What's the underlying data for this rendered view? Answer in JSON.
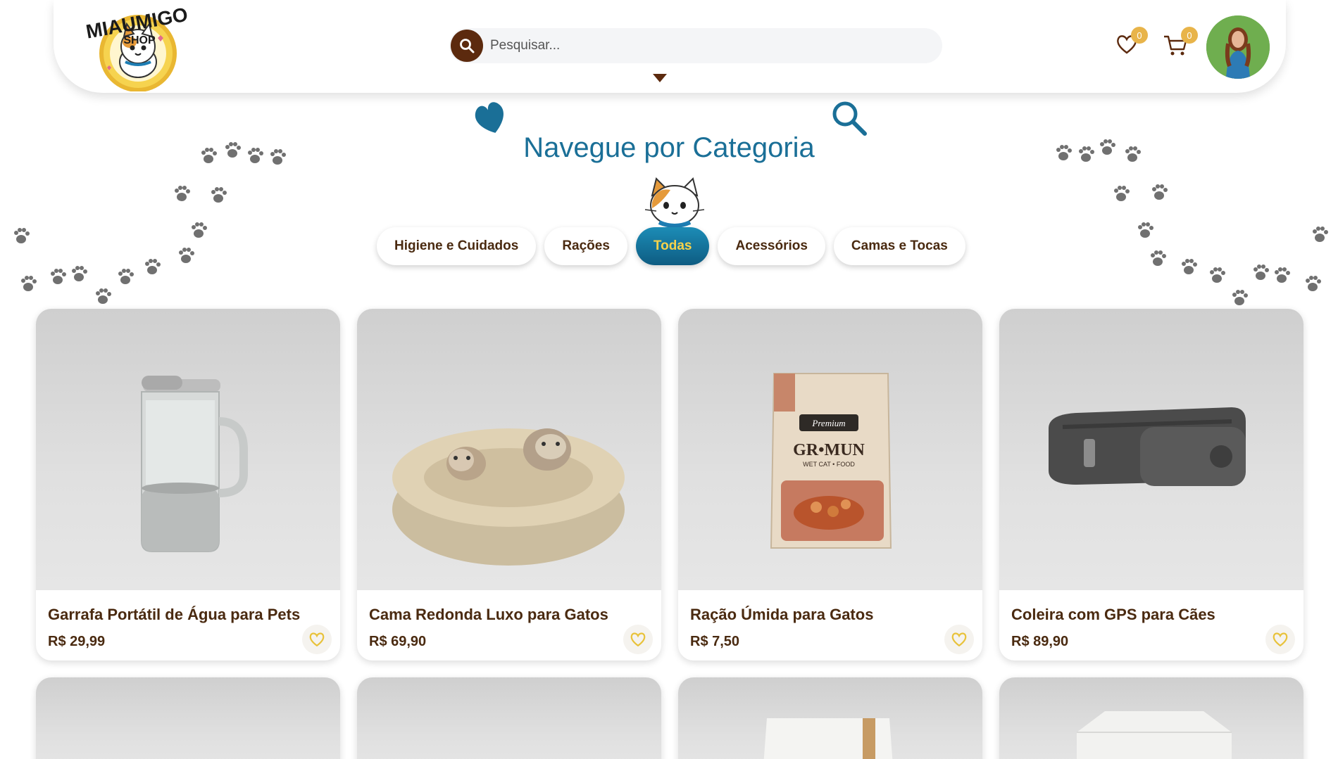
{
  "header": {
    "logo_text_top": "MIAUMIGO",
    "logo_text_bottom": "SHOP",
    "search_placeholder": "Pesquisar...",
    "wishlist_count": "0",
    "cart_count": "0"
  },
  "categories": {
    "title": "Navegue por Categoria",
    "items": [
      {
        "label": "Higiene e Cuidados"
      },
      {
        "label": "Rações"
      },
      {
        "label": "Todas"
      },
      {
        "label": "Acessórios"
      },
      {
        "label": "Camas e Tocas"
      }
    ],
    "active": "Todas"
  },
  "products": [
    {
      "name": "Garrafa Portátil de Água para Pets",
      "price": "R$ 29,99"
    },
    {
      "name": "Cama Redonda Luxo para Gatos",
      "price": "R$ 69,90"
    },
    {
      "name": "Ração Úmida para Gatos",
      "price": "R$ 7,50"
    },
    {
      "name": "Coleira com GPS para Cães",
      "price": "R$ 89,90"
    }
  ],
  "food_bag": {
    "brand": "Premium",
    "name": "GR•MUN",
    "subtitle": "WET CAT • FOOD"
  },
  "colors": {
    "brand_brown": "#5c2a0e",
    "accent_blue": "#1a6f97",
    "accent_yellow": "#e8b44a"
  },
  "icons": [
    "search-icon",
    "heart-icon",
    "cart-icon",
    "paw-icon",
    "magnifier-icon"
  ]
}
